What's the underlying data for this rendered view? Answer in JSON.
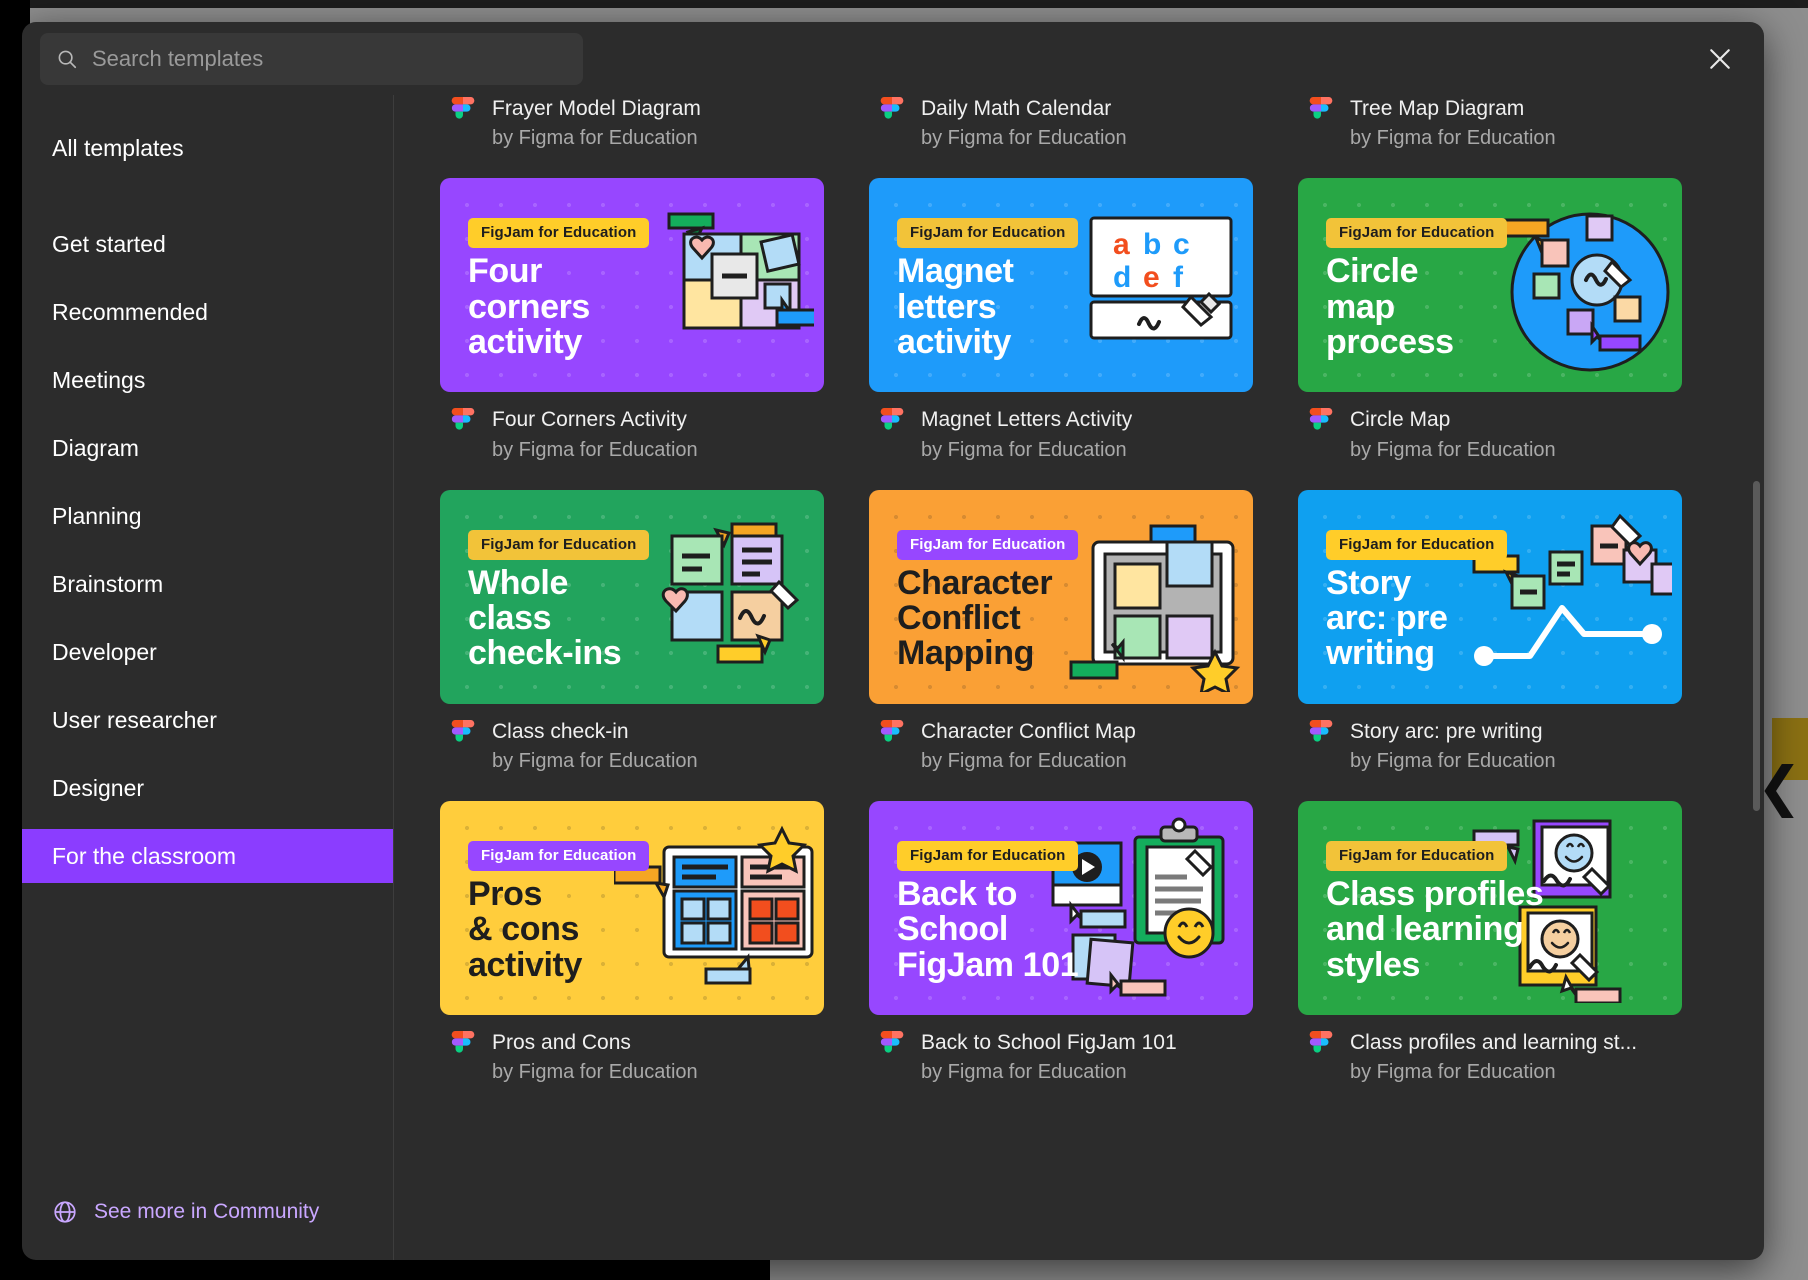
{
  "header": {
    "search": {
      "placeholder": "Search templates",
      "value": ""
    },
    "search_icon": "search-icon",
    "close_icon": "close-icon"
  },
  "sidebar": {
    "items": [
      {
        "label": "All templates",
        "active": false
      },
      {
        "label": "Get started",
        "active": false
      },
      {
        "label": "Recommended",
        "active": false
      },
      {
        "label": "Meetings",
        "active": false
      },
      {
        "label": "Diagram",
        "active": false
      },
      {
        "label": "Planning",
        "active": false
      },
      {
        "label": "Brainstorm",
        "active": false
      },
      {
        "label": "Developer",
        "active": false
      },
      {
        "label": "User researcher",
        "active": false
      },
      {
        "label": "Designer",
        "active": false
      },
      {
        "label": "For the classroom",
        "active": true
      }
    ],
    "footer": {
      "label": "See more in Community",
      "icon": "globe-icon"
    },
    "active_color": "#8b3dff",
    "link_color": "#c9a7ff"
  },
  "partial_row": [
    {
      "name": "Frayer Model Diagram",
      "author": "by Figma for Education"
    },
    {
      "name": "Daily Math Calendar",
      "author": "by Figma for Education"
    },
    {
      "name": "Tree Map Diagram",
      "author": "by Figma for Education"
    }
  ],
  "templates": [
    {
      "name": "Four Corners Activity",
      "author": "by Figma for Education",
      "badge": "FigJam for Education",
      "title": "Four\ncorners\nactivity",
      "bg": "#9747ff",
      "title_color": "#ffffff",
      "badge_bg": "#ffcd29",
      "badge_color": "#1e1e1e",
      "art": "four-corners"
    },
    {
      "name": "Magnet Letters Activity",
      "author": "by Figma for Education",
      "badge": "FigJam for Education",
      "title": "Magnet\nletters\nactivity",
      "bg": "#1e9bfa",
      "title_color": "#ffffff",
      "badge_bg": "#f2c339",
      "badge_color": "#1e1e1e",
      "art": "magnet-letters",
      "letters_row1": [
        "a",
        "b",
        "c"
      ],
      "letters_row2": [
        "d",
        "e",
        "f"
      ]
    },
    {
      "name": "Circle Map",
      "author": "by Figma for Education",
      "badge": "FigJam for Education",
      "title": "Circle\nmap\nprocess",
      "bg": "#28a745",
      "title_color": "#ffffff",
      "badge_bg": "#f2c339",
      "badge_color": "#1e1e1e",
      "art": "circle-map"
    },
    {
      "name": "Class check-in",
      "author": "by Figma for Education",
      "badge": "FigJam for Education",
      "title": "Whole\nclass\ncheck-ins",
      "bg": "#22a45d",
      "title_color": "#ffffff",
      "badge_bg": "#f2c339",
      "badge_color": "#1e1e1e",
      "art": "class-checkin"
    },
    {
      "name": "Character Conflict Map",
      "author": "by Figma for Education",
      "badge": "FigJam for Education",
      "title": "Character\nConflict\nMapping",
      "bg": "#faa035",
      "title_color": "#1e1e1e",
      "badge_bg": "#9747ff",
      "badge_color": "#ffffff",
      "art": "conflict-map"
    },
    {
      "name": "Story arc: pre writing",
      "author": "by Figma for Education",
      "badge": "FigJam for Education",
      "title": "Story\narc: pre\nwriting",
      "bg": "#0fa0f0",
      "title_color": "#ffffff",
      "badge_bg": "#ffcd29",
      "badge_color": "#1e1e1e",
      "art": "story-arc"
    },
    {
      "name": "Pros and Cons",
      "author": "by Figma for Education",
      "badge": "FigJam for Education",
      "title": "Pros\n& cons\nactivity",
      "bg": "#ffcd3c",
      "title_color": "#1e1e1e",
      "badge_bg": "#9747ff",
      "badge_color": "#ffffff",
      "art": "pros-cons"
    },
    {
      "name": "Back to School FigJam 101",
      "author": "by Figma for Education",
      "badge": "FigJam for Education",
      "title": "Back to\nSchool\nFigJam 101",
      "bg": "#9747ff",
      "title_color": "#ffffff",
      "badge_bg": "#ffcd29",
      "badge_color": "#1e1e1e",
      "art": "back-to-school"
    },
    {
      "name": "Class profiles and learning st...",
      "author": "by Figma for Education",
      "badge": "FigJam for Education",
      "title": "Class profiles\nand learning\nstyles",
      "bg": "#28a745",
      "title_color": "#ffffff",
      "badge_bg": "#f2c339",
      "badge_color": "#1e1e1e",
      "art": "class-profiles"
    }
  ]
}
